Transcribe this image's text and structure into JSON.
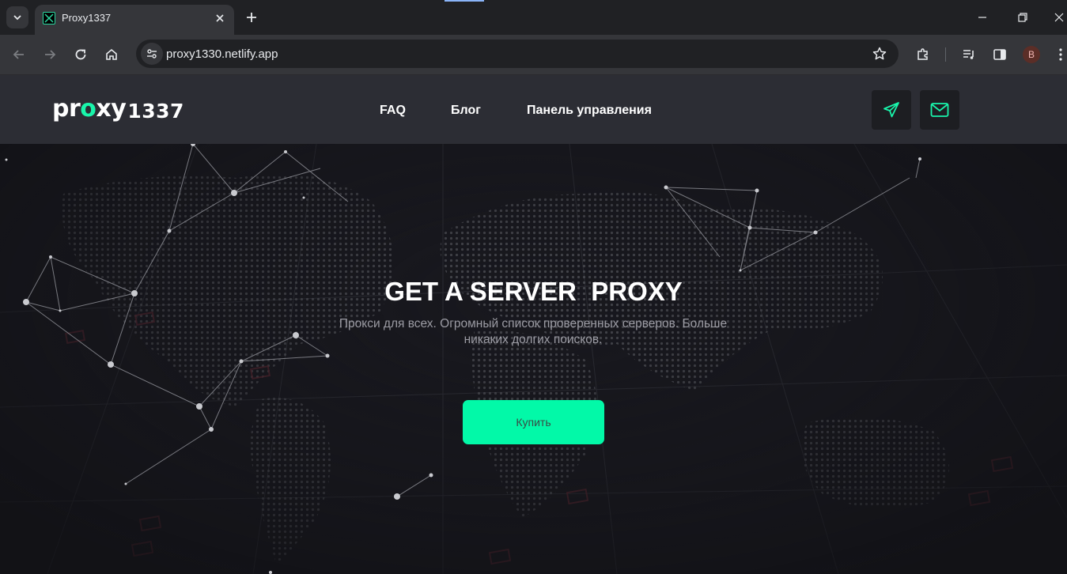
{
  "browser": {
    "tab": {
      "title": "Proxy1337"
    },
    "address_bar": {
      "url": "proxy1330.netlify.app"
    },
    "profile_initial": "B",
    "icons": [
      "tab-search-icon",
      "close-icon",
      "plus-icon",
      "minimize-icon",
      "restore-icon",
      "back-arrow-icon",
      "forward-arrow-icon",
      "reload-icon",
      "home-icon",
      "site-settings-icon",
      "star-icon",
      "extensions-icon",
      "media-controls-icon",
      "side-panel-icon",
      "kebab-menu-icon"
    ]
  },
  "site": {
    "logo": {
      "prefix": "pr",
      "accent": "o",
      "suffix": "xy",
      "number": "1337"
    },
    "nav": [
      {
        "label": "FAQ"
      },
      {
        "label": "Блог"
      },
      {
        "label": "Панель управления"
      }
    ],
    "contacts": [
      {
        "icon": "telegram-icon"
      },
      {
        "icon": "mail-icon"
      }
    ],
    "hero": {
      "title": "GET A SERVER  PROXY",
      "subtitle": "Прокси для всех. Огромный список проверенных серверов. Больше никаких долгих поисков.",
      "button_label": "Купить"
    },
    "colors": {
      "accent": "#02f9a8",
      "header_bg": "#2c2d34",
      "page_bg": "#18181e",
      "text_primary": "#ffffff",
      "text_muted": "#9c9ca4"
    }
  }
}
